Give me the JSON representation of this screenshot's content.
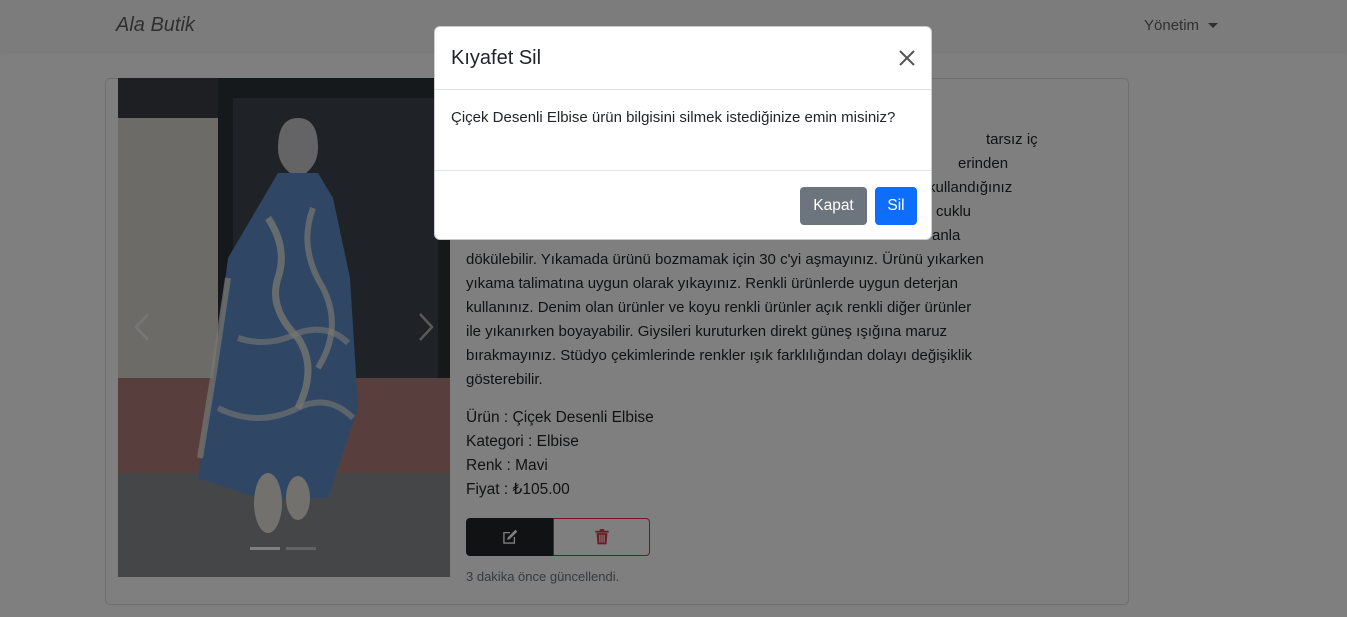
{
  "navbar": {
    "brand": "Ala Butik",
    "dropdown_label": "Yönetim"
  },
  "product": {
    "description_full": "... tarsız iç ... erinden ... kullandığınız ... cuklu ... anla dökülebilir. Yıkamada ürünü bozmamak için 30 c'yi aşmayınız. Ürünü yıkarken yıkama talimatına uygun olarak yıkayınız. Renkli ürünlerde uygun deterjan kullanınız. Denim olan ürünler ve koyu renkli ürünler açık renkli diğer ürünler ile yıkanırken boyayabilir. Giysileri kuruturken direkt güneş ışığına maruz bırakmayınız. Stüdyo çekimlerinde renkler ışık farklılığından dolayı değişiklik gösterebilir.",
    "description_visible_fragments": [
      "tarsız iç",
      "erinden",
      "kullandığınız",
      "cuklu",
      "anla"
    ],
    "description_lines": [
      "dökülebilir. Yıkamada ürünü bozmamak için 30 c'yi aşmayınız. Ürünü yıkarken",
      "yıkama talimatına uygun olarak yıkayınız. Renkli ürünlerde uygun deterjan",
      "kullanınız. Denim olan ürünler ve koyu renkli ürünler açık renkli diğer ürünler",
      "ile yıkanırken boyayabilir. Giysileri kuruturken direkt güneş ışığına maruz",
      "bırakmayınız. Stüdyo çekimlerinde renkler ışık farklılığından dolayı değişiklik",
      "gösterebilir."
    ],
    "name_line": "Ürün : Çiçek Desenli Elbise",
    "category_line": "Kategori : Elbise",
    "color_line": "Renk : Mavi",
    "price_line": "Fiyat : ₺105.00",
    "updated_text": "3 dakika önce güncellendi.",
    "carousel": {
      "slide_count": 2,
      "active_slide": 1
    }
  },
  "modal": {
    "title": "Kıyafet Sil",
    "body_text": "Çiçek Desenli Elbise ürün bilgisini silmek istediğinize emin misiniz?",
    "close_label": "Kapat",
    "confirm_label": "Sil"
  },
  "colors": {
    "primary": "#0d6efd",
    "secondary": "#6c757d",
    "danger": "#dc3545",
    "dark": "#212529"
  },
  "icons": {
    "edit": "pencil-square-icon",
    "delete": "trash-icon",
    "close": "close-icon",
    "prev": "chevron-left-icon",
    "next": "chevron-right-icon"
  }
}
